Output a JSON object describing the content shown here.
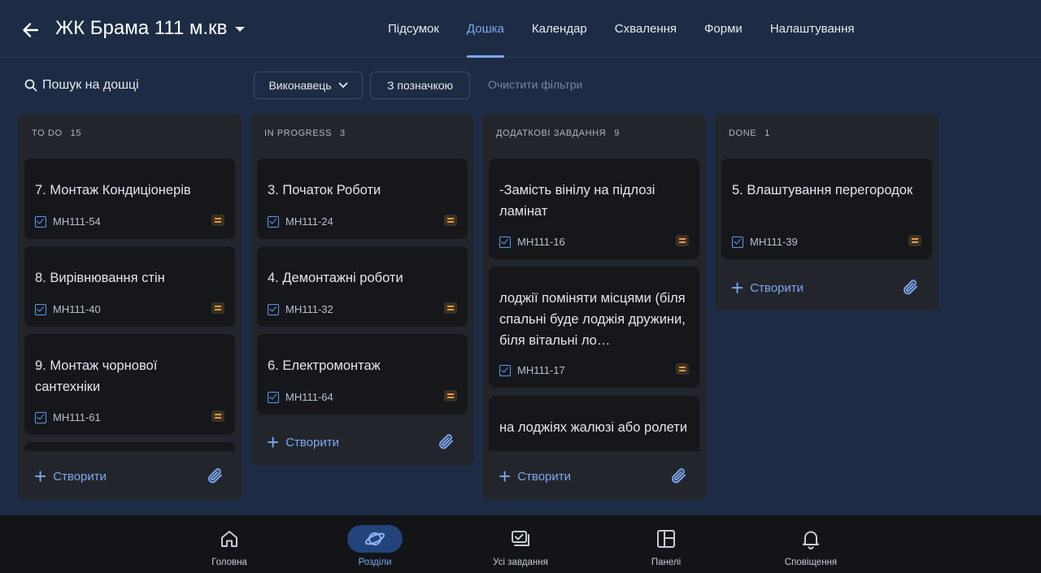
{
  "header": {
    "title": "ЖК Брама 111 м.кв",
    "tabs": [
      {
        "label": "Підсумок"
      },
      {
        "label": "Дошка"
      },
      {
        "label": "Календар"
      },
      {
        "label": "Схвалення"
      },
      {
        "label": "Форми"
      },
      {
        "label": "Налаштування"
      }
    ],
    "active_tab": "Дошка"
  },
  "toolbar": {
    "search_label": "Пошук на дошці",
    "assignee_filter": "Виконавець",
    "label_filter": "З позначкою",
    "clear_filters": "Очистити фільтри"
  },
  "columns": [
    {
      "name": "TO DO",
      "count": "15",
      "cards": [
        {
          "title": "7. Монтаж Кондиціонерів",
          "key": "MH111-54"
        },
        {
          "title": "8. Вирівнювання стін",
          "key": "MH111-40"
        },
        {
          "title": "9.  Монтаж чорнової сантехніки",
          "key": "MH111-61"
        }
      ],
      "create_label": "Створити"
    },
    {
      "name": "IN PROGRESS",
      "count": "3",
      "cards": [
        {
          "title": "3. Початок Роботи",
          "key": "MH111-24"
        },
        {
          "title": "4. Демонтажні роботи",
          "key": "MH111-32"
        },
        {
          "title": "6. Електромонтаж",
          "key": "MH111-64"
        }
      ],
      "create_label": "Створити"
    },
    {
      "name": "ДОДАТКОВІ ЗАВДАННЯ",
      "count": "9",
      "cards": [
        {
          "title": "-Замість вінілу на підлозі ламінат",
          "key": "MH111-16"
        },
        {
          "title": "лоджії поміняти місцями (біля спальні буде лоджія дружини, біля вітальні ло…",
          "key": "MH111-17"
        },
        {
          "title": "на лоджіях жалюзі або ролети",
          "key": ""
        }
      ],
      "create_label": "Створити"
    },
    {
      "name": "DONE",
      "count": "1",
      "cards": [
        {
          "title": "5. Влаштування перегородок",
          "key": "MH111-39"
        }
      ],
      "create_label": "Створити"
    }
  ],
  "bottom_nav": [
    {
      "label": "Головна",
      "icon": "home-icon"
    },
    {
      "label": "Розділи",
      "icon": "planet-icon"
    },
    {
      "label": "Усі завдання",
      "icon": "tasks-icon"
    },
    {
      "label": "Панелі",
      "icon": "dashboard-icon"
    },
    {
      "label": "Сповіщення",
      "icon": "bell-icon"
    }
  ],
  "colors": {
    "background": "#1d2c44",
    "column": "#22262c",
    "card": "#15171b",
    "accent": "#7da7f0",
    "priority": "#e89b3a"
  }
}
